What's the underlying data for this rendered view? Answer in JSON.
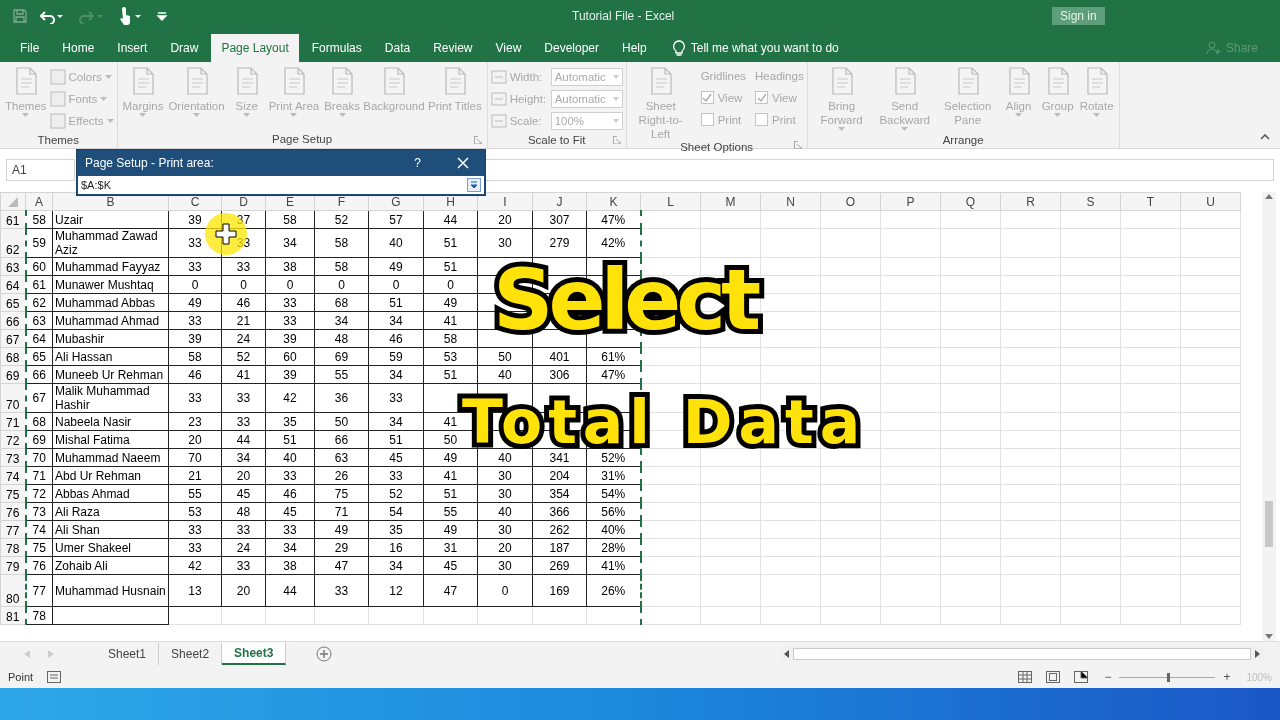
{
  "window": {
    "title": "Tutorial File  -  Excel",
    "sign_in": "Sign in",
    "share": "Share"
  },
  "tabs": [
    {
      "label": "File",
      "selected": false
    },
    {
      "label": "Home",
      "selected": false
    },
    {
      "label": "Insert",
      "selected": false
    },
    {
      "label": "Draw",
      "selected": false
    },
    {
      "label": "Page Layout",
      "selected": true
    },
    {
      "label": "Formulas",
      "selected": false
    },
    {
      "label": "Data",
      "selected": false
    },
    {
      "label": "Review",
      "selected": false
    },
    {
      "label": "View",
      "selected": false
    },
    {
      "label": "Developer",
      "selected": false
    },
    {
      "label": "Help",
      "selected": false
    }
  ],
  "tell_me": "Tell me what you want to do",
  "ribbon": [
    {
      "label": "Themes",
      "launcher": false,
      "columns": [
        [
          {
            "kind": "large",
            "label": "Themes",
            "dropdown": true
          }
        ],
        [
          {
            "kind": "small",
            "label": "Colors",
            "dropdown": true
          },
          {
            "kind": "small",
            "label": "Fonts",
            "dropdown": true
          },
          {
            "kind": "small",
            "label": "Effects",
            "dropdown": true
          }
        ]
      ]
    },
    {
      "label": "Page Setup",
      "launcher": true,
      "columns": [
        [
          {
            "kind": "large",
            "label": "Margins",
            "dropdown": true
          }
        ],
        [
          {
            "kind": "large",
            "label": "Orientation",
            "dropdown": true
          }
        ],
        [
          {
            "kind": "large",
            "label": "Size",
            "dropdown": true
          }
        ],
        [
          {
            "kind": "large",
            "label": "Print Area",
            "dropdown": true
          }
        ],
        [
          {
            "kind": "large",
            "label": "Breaks",
            "dropdown": true
          }
        ],
        [
          {
            "kind": "large",
            "label": "Background",
            "dropdown": false
          }
        ],
        [
          {
            "kind": "large",
            "label": "Print Titles",
            "dropdown": false
          }
        ]
      ]
    },
    {
      "label": "Scale to Fit",
      "launcher": true,
      "columns": [
        [
          {
            "kind": "field",
            "label": "Width:",
            "value": "Automatic"
          },
          {
            "kind": "field",
            "label": "Height:",
            "value": "Automatic"
          },
          {
            "kind": "field",
            "label": "Scale:",
            "value": "100%"
          }
        ]
      ]
    },
    {
      "label": "Sheet Options",
      "launcher": true,
      "columns": [
        [
          {
            "kind": "large",
            "label": "Sheet Right-to-Left",
            "dropdown": false
          }
        ],
        [
          {
            "kind": "heading",
            "label": "Gridlines"
          },
          {
            "kind": "check",
            "label": "View",
            "checked": true
          },
          {
            "kind": "check",
            "label": "Print",
            "checked": false
          }
        ],
        [
          {
            "kind": "heading",
            "label": "Headings"
          },
          {
            "kind": "check",
            "label": "View",
            "checked": true
          },
          {
            "kind": "check",
            "label": "Print",
            "checked": false
          }
        ]
      ]
    },
    {
      "label": "Arrange",
      "launcher": false,
      "columns": [
        [
          {
            "kind": "large",
            "label": "Bring Forward",
            "dropdown": true
          }
        ],
        [
          {
            "kind": "large",
            "label": "Send Backward",
            "dropdown": true
          }
        ],
        [
          {
            "kind": "large",
            "label": "Selection Pane",
            "dropdown": false
          }
        ],
        [
          {
            "kind": "large",
            "label": "Align",
            "dropdown": true
          }
        ],
        [
          {
            "kind": "large",
            "label": "Group",
            "dropdown": true
          }
        ],
        [
          {
            "kind": "large",
            "label": "Rotate",
            "dropdown": true
          }
        ]
      ]
    }
  ],
  "name_box": "A1",
  "dialog": {
    "title": "Page Setup - Print area:",
    "help": "?",
    "value": "$A:$K"
  },
  "columns": [
    "A",
    "B",
    "C",
    "D",
    "E",
    "F",
    "G",
    "H",
    "I",
    "J",
    "K",
    "L",
    "M",
    "N",
    "O",
    "P",
    "Q",
    "R",
    "S",
    "T",
    "U"
  ],
  "rows": [
    {
      "num": "61",
      "cells": [
        "58",
        "Uzair",
        "39",
        "37",
        "58",
        "52",
        "57",
        "44",
        "20",
        "307",
        "47%"
      ]
    },
    {
      "num": "62",
      "cells": [
        "59",
        "Muhammad Zawad Aziz",
        "33",
        "33",
        "34",
        "58",
        "40",
        "51",
        "30",
        "279",
        "42%"
      ]
    },
    {
      "num": "63",
      "cells": [
        "60",
        "Muhammad Fayyaz",
        "33",
        "33",
        "38",
        "58",
        "49",
        "51",
        null,
        null,
        null
      ]
    },
    {
      "num": "64",
      "cells": [
        "61",
        "Munawer Mushtaq",
        "0",
        "0",
        "0",
        "0",
        "0",
        "0",
        null,
        null,
        null
      ]
    },
    {
      "num": "65",
      "cells": [
        "62",
        "Muhammad Abbas",
        "49",
        "46",
        "33",
        "68",
        "51",
        "49",
        null,
        null,
        null
      ]
    },
    {
      "num": "66",
      "cells": [
        "63",
        "Muhammad Ahmad",
        "33",
        "21",
        "33",
        "34",
        "34",
        "41",
        null,
        null,
        null
      ]
    },
    {
      "num": "67",
      "cells": [
        "64",
        "Mubashir",
        "39",
        "24",
        "39",
        "48",
        "46",
        "58",
        null,
        null,
        null
      ]
    },
    {
      "num": "68",
      "cells": [
        "65",
        "Ali Hassan",
        "58",
        "52",
        "60",
        "69",
        "59",
        "53",
        "50",
        "401",
        "61%"
      ]
    },
    {
      "num": "69",
      "cells": [
        "66",
        "Muneeb Ur Rehman",
        "46",
        "41",
        "39",
        "55",
        "34",
        "51",
        "40",
        "306",
        "47%"
      ]
    },
    {
      "num": "70",
      "cells": [
        "67",
        "Malik Muhammad Hashir",
        "33",
        "33",
        "42",
        "36",
        "33",
        null,
        null,
        null,
        null
      ]
    },
    {
      "num": "71",
      "cells": [
        "68",
        "Nabeela Nasir",
        "23",
        "33",
        "35",
        "50",
        "34",
        "41",
        null,
        null,
        null
      ]
    },
    {
      "num": "72",
      "cells": [
        "69",
        "Mishal Fatima",
        "20",
        "44",
        "51",
        "66",
        "51",
        "50",
        null,
        null,
        null
      ]
    },
    {
      "num": "73",
      "cells": [
        "70",
        "Muhammad Naeem",
        "70",
        "34",
        "40",
        "63",
        "45",
        "49",
        "40",
        "341",
        "52%"
      ]
    },
    {
      "num": "74",
      "cells": [
        "71",
        "Abd Ur Rehman",
        "21",
        "20",
        "33",
        "26",
        "33",
        "41",
        "30",
        "204",
        "31%"
      ]
    },
    {
      "num": "75",
      "cells": [
        "72",
        "Abbas Ahmad",
        "55",
        "45",
        "46",
        "75",
        "52",
        "51",
        "30",
        "354",
        "54%"
      ]
    },
    {
      "num": "76",
      "cells": [
        "73",
        "Ali Raza",
        "53",
        "48",
        "45",
        "71",
        "54",
        "55",
        "40",
        "366",
        "56%"
      ]
    },
    {
      "num": "77",
      "cells": [
        "74",
        "Ali Shan",
        "33",
        "33",
        "33",
        "49",
        "35",
        "49",
        "30",
        "262",
        "40%"
      ]
    },
    {
      "num": "78",
      "cells": [
        "75",
        "Umer Shakeel",
        "33",
        "24",
        "34",
        "29",
        "16",
        "31",
        "20",
        "187",
        "28%"
      ]
    },
    {
      "num": "79",
      "cells": [
        "76",
        "Zohaib Ali",
        "42",
        "33",
        "38",
        "47",
        "34",
        "45",
        "30",
        "269",
        "41%"
      ]
    },
    {
      "num": "80",
      "cells": [
        "77",
        "Muhammad Husnain",
        "13",
        "20",
        "44",
        "33",
        "12",
        "47",
        "0",
        "169",
        "26%"
      ]
    },
    {
      "num": "81",
      "cells": [
        "78",
        null
      ]
    }
  ],
  "caption": [
    "Select",
    "Total Data"
  ],
  "sheets": [
    {
      "label": "Sheet1",
      "selected": false
    },
    {
      "label": "Sheet2",
      "selected": false
    },
    {
      "label": "Sheet3",
      "selected": true
    }
  ],
  "status": "Point",
  "zoom_out": "−",
  "zoom_in": "+",
  "zoom_slider": {
    "level": 0.5
  },
  "zoom": "100%"
}
